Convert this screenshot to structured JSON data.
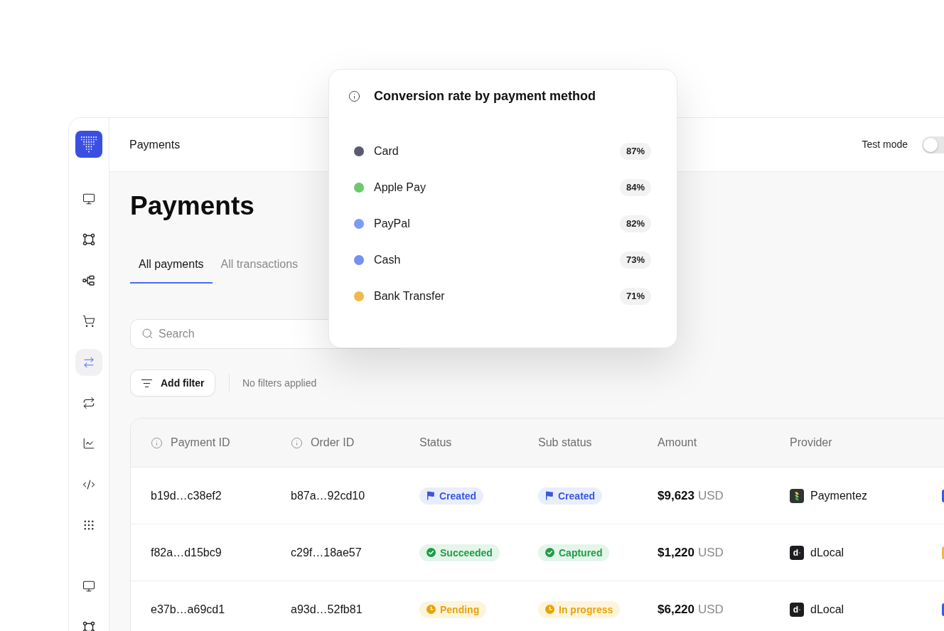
{
  "sidebar": {
    "items": [
      {
        "selected": false
      },
      {
        "selected": false
      },
      {
        "selected": false
      },
      {
        "selected": false
      },
      {
        "selected": true
      },
      {
        "selected": false
      },
      {
        "selected": false
      },
      {
        "selected": false
      },
      {
        "selected": false
      }
    ],
    "bottom_items": [
      {
        "selected": false
      },
      {
        "selected": false
      }
    ]
  },
  "header": {
    "title": "Payments",
    "test_mode": {
      "label": "Test mode",
      "on": false
    }
  },
  "page": {
    "title": "Payments"
  },
  "tabs": [
    {
      "label": "All payments",
      "selected": true
    },
    {
      "label": "All transactions",
      "selected": false
    }
  ],
  "search": {
    "placeholder": "Search"
  },
  "filters": {
    "button": "Add filter",
    "status": "No filters applied"
  },
  "table": {
    "columns": [
      {
        "label": "Payment ID",
        "info": true
      },
      {
        "label": "Order ID",
        "info": true
      },
      {
        "label": "Status",
        "info": false
      },
      {
        "label": "Sub status",
        "info": false
      },
      {
        "label": "Amount",
        "info": false
      },
      {
        "label": "Provider",
        "info": false
      }
    ],
    "rows": [
      {
        "payment_id": "b19d…c38ef2",
        "order_id": "b87a…92cd10",
        "status": {
          "label": "Created",
          "kind": "created"
        },
        "sub_status": {
          "label": "Created",
          "kind": "created"
        },
        "amount": "$9,623",
        "currency": "USD",
        "provider": {
          "name": "Paymentez",
          "kind": "stripes"
        },
        "column_7": {
          "color": "#3b5bdb"
        }
      },
      {
        "payment_id": "f82a…d15bc9",
        "order_id": "c29f…18ae57",
        "status": {
          "label": "Succeeded",
          "kind": "succeeded"
        },
        "sub_status": {
          "label": "Captured",
          "kind": "succeeded"
        },
        "amount": "$1,220",
        "currency": "USD",
        "provider": {
          "name": "dLocal",
          "kind": "letter",
          "mark": "d"
        },
        "column_7": {
          "color": "#f0b84a"
        }
      },
      {
        "payment_id": "e37b…a69cd1",
        "order_id": "a93d…52fb81",
        "status": {
          "label": "Pending",
          "kind": "pending"
        },
        "sub_status": {
          "label": "In progress",
          "kind": "pending"
        },
        "amount": "$6,220",
        "currency": "USD",
        "provider": {
          "name": "dLocal",
          "kind": "letter",
          "mark": "d"
        },
        "column_7": {
          "color": "#3b5bdb"
        }
      }
    ]
  },
  "popover": {
    "title": "Conversion rate by payment method",
    "methods": [
      {
        "name": "Card",
        "color": "#5a5a72",
        "rate": "87%"
      },
      {
        "name": "Apple Pay",
        "color": "#6cc96a",
        "rate": "84%"
      },
      {
        "name": "PayPal",
        "color": "#7b9cf5",
        "rate": "82%"
      },
      {
        "name": "Cash",
        "color": "#7490f2",
        "rate": "73%"
      },
      {
        "name": "Bank Transfer",
        "color": "#f2b84b",
        "rate": "71%"
      }
    ]
  }
}
